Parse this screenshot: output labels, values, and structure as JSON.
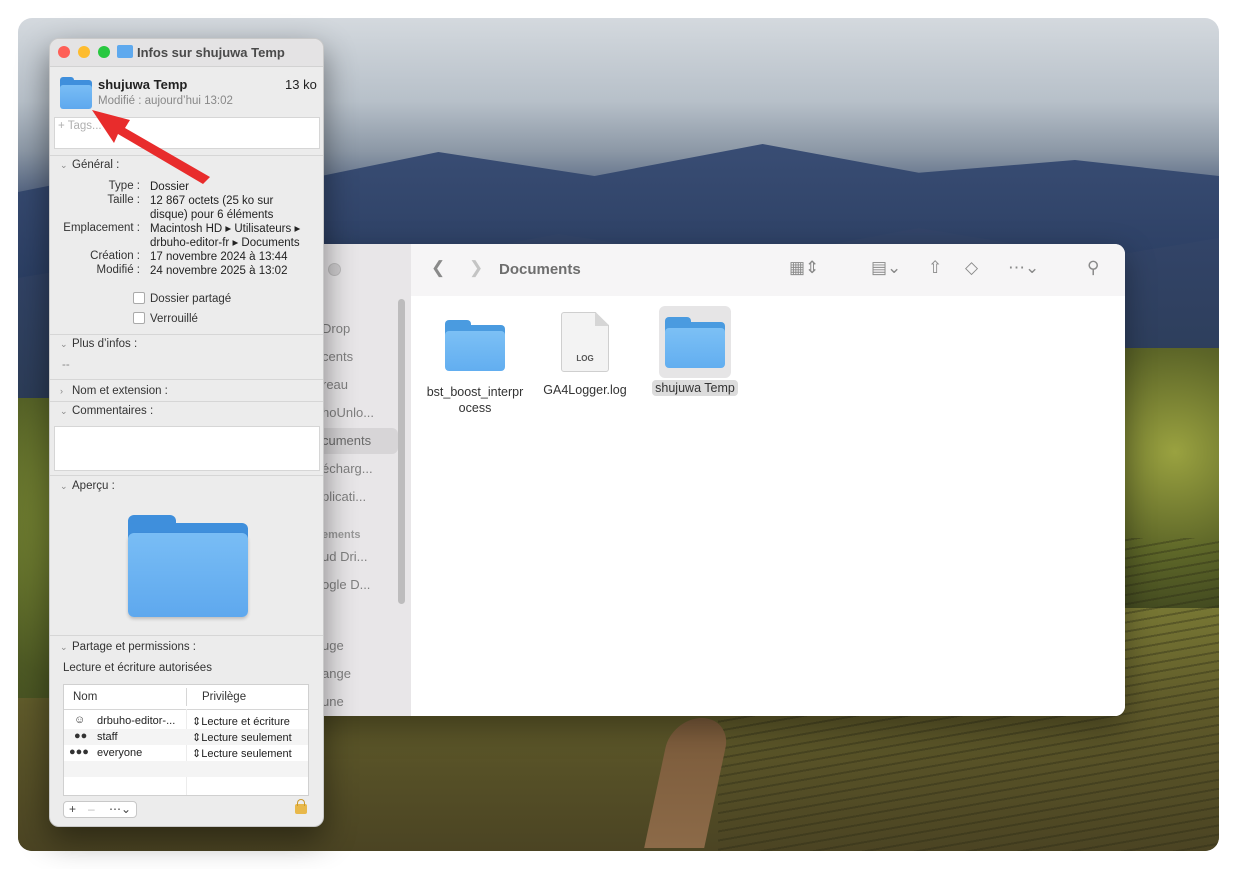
{
  "finder": {
    "title": "Documents",
    "sidebar": {
      "items": [
        "Drop",
        "cents",
        "reau",
        "hoUnlo...",
        "cuments",
        "écharg...",
        "plicati...",
        "ud Dri...",
        "ogle D...",
        "uge",
        "ange",
        "une"
      ],
      "section_header": "ements"
    },
    "files": [
      {
        "name": "bst_boost_interprocess",
        "kind": "folder"
      },
      {
        "name": "GA4Logger.log",
        "kind": "document",
        "badge": "LOG"
      },
      {
        "name": "shujuwa Temp",
        "kind": "folder",
        "selected": true
      }
    ]
  },
  "info": {
    "window_title": "Infos sur shujuwa Temp",
    "name": "shujuwa Temp",
    "size": "13 ko",
    "modified_line": "Modifié : aujourd’hui 13:02",
    "tags_placeholder": "+ Tags...",
    "general": {
      "header": "Général :",
      "type_label": "Type :",
      "type_value": "Dossier",
      "size_label": "Taille :",
      "size_value": "12 867 octets (25 ko sur disque) pour 6 éléments",
      "location_label": "Emplacement :",
      "location_value": "Macintosh HD ▸ Utilisateurs ▸ drbuho-editor-fr ▸ Documents",
      "created_label": "Création :",
      "created_value": "17 novembre 2024 à 13:44",
      "modified_label": "Modifié :",
      "modified_value": "24 novembre 2025 à 13:02",
      "shared_folder": "Dossier partagé",
      "locked": "Verrouillé"
    },
    "more_info": {
      "header": "Plus d’infos :",
      "value": "--"
    },
    "name_ext": {
      "header": "Nom et extension :"
    },
    "comments": {
      "header": "Commentaires :"
    },
    "preview": {
      "header": "Aperçu :"
    },
    "sharing": {
      "header": "Partage et permissions :",
      "summary": "Lecture et écriture autorisées",
      "col_name": "Nom",
      "col_privilege": "Privilège",
      "rows": [
        {
          "name": "drbuho-editor-...",
          "privilege": "Lecture et écriture",
          "icon": "user-icon"
        },
        {
          "name": "staff",
          "privilege": "Lecture seulement",
          "icon": "group-icon"
        },
        {
          "name": "everyone",
          "privilege": "Lecture seulement",
          "icon": "everyone-icon"
        }
      ]
    }
  },
  "colors": {
    "close": "#fe5f57",
    "minimize": "#febc2e",
    "zoom": "#28c840",
    "arrow": "#e82c2c",
    "folder": "#62aef0"
  }
}
